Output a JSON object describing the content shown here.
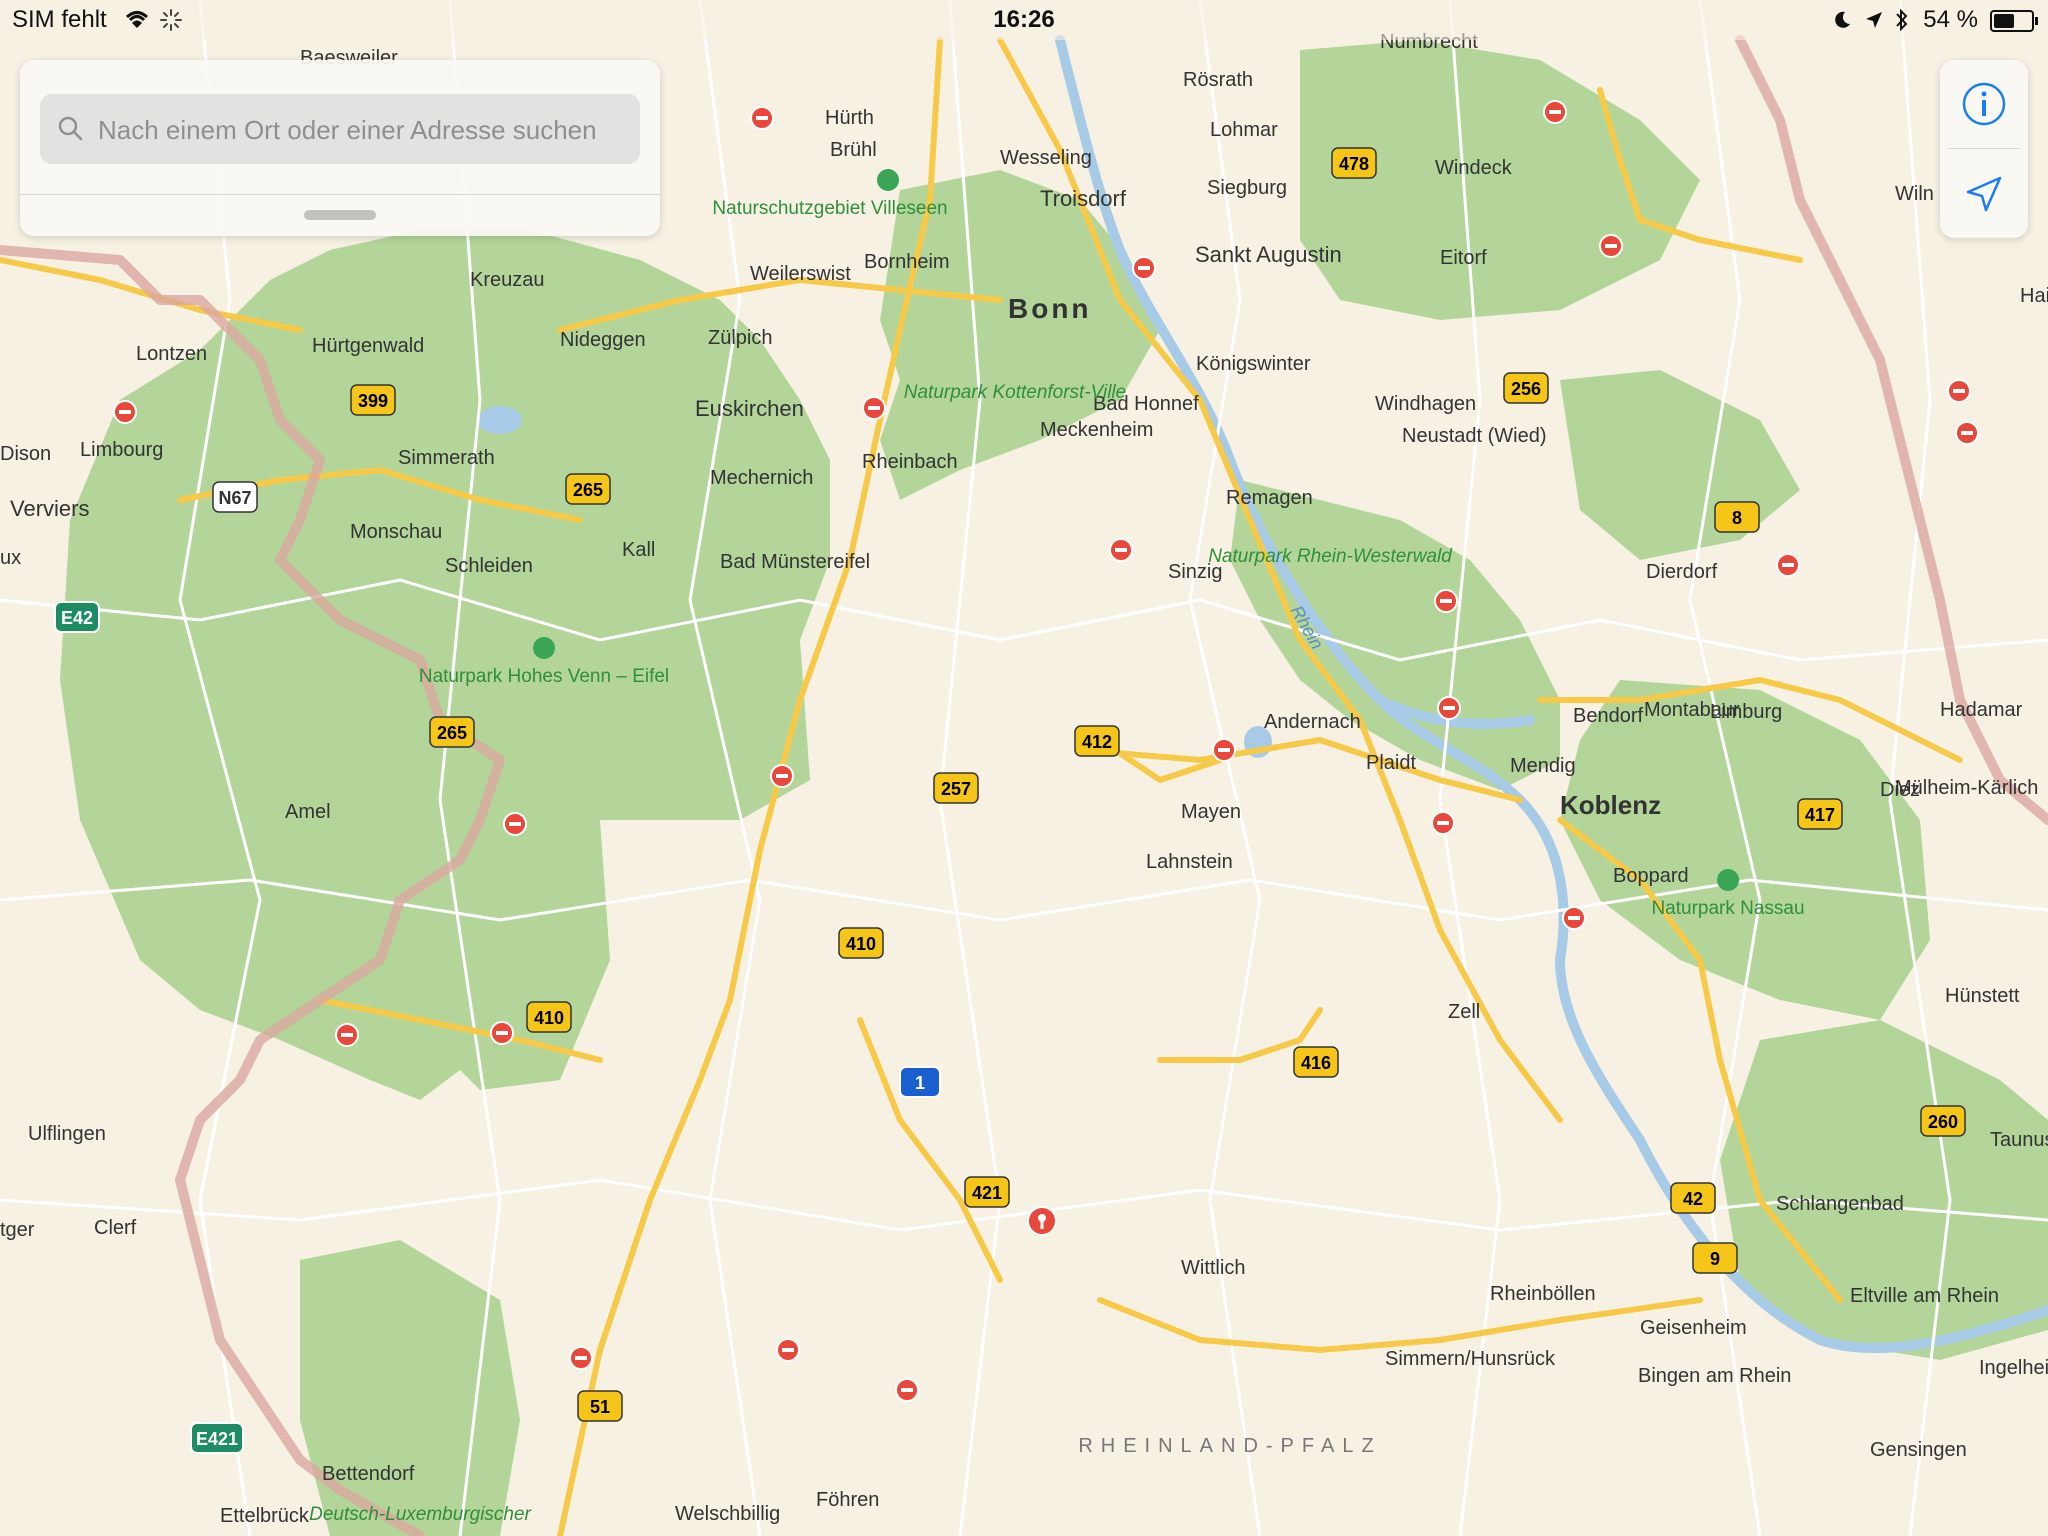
{
  "status_bar": {
    "carrier": "SIM fehlt",
    "time": "16:26",
    "battery": "54 %",
    "icons": [
      "wifi-icon",
      "activity-spinner-icon",
      "moon-icon",
      "location-arrow-icon",
      "bluetooth-icon",
      "battery-icon"
    ]
  },
  "search": {
    "placeholder": "Nach einem Ort oder einer Adresse suchen",
    "icon": "search-icon"
  },
  "controls": {
    "info_icon": "info-icon",
    "location_icon": "location-arrow-icon"
  },
  "colors": {
    "land": "#f7f1e3",
    "park": "#a8d08d",
    "road_major": "#f7c948",
    "road_minor": "#ffffff",
    "water": "#a7cbe6",
    "border": "#d9a7a0",
    "marker": "#e8473c",
    "shield": "#f5c518",
    "accent": "#1a7ef2"
  },
  "places": {
    "cities": [
      "Bonn",
      "Koblenz"
    ],
    "towns": [
      "Hürth",
      "Brühl",
      "Rösrath",
      "Lohmar",
      "Wesseling",
      "Troisdorf",
      "Siegburg",
      "Sankt Augustin",
      "Windeck",
      "Eitorf",
      "Bornheim",
      "Weilerswist",
      "Zülpich",
      "Euskirchen",
      "Nideggen",
      "Kreuzau",
      "Hürtgenwald",
      "Lontzen",
      "Limbourg",
      "Dison",
      "Verviers",
      "Simmerath",
      "Monschau",
      "Schleiden",
      "Mechernich",
      "Kall",
      "Bad Münstereifel",
      "Rheinbach",
      "Meckenheim",
      "Bad Honnef",
      "Königswinter",
      "Windhagen",
      "Neustadt (Wied)",
      "Remagen",
      "Sinzig",
      "Dierdorf",
      "Andernach",
      "Plaidt",
      "Bendorf",
      "Montabaur",
      "Hadamar",
      "Limburg",
      "Diez",
      "Mülheim-Kärlich",
      "Mendig",
      "Mayen",
      "Lahnstein",
      "Boppard",
      "Zell",
      "Wittlich",
      "Föhren",
      "Welschbillig",
      "Bettendorf",
      "Ettelbrück",
      "Clerf",
      "Ulflingen",
      "Amel",
      "Rheinböllen",
      "Simmern/Hunsrück",
      "Bingen am Rhein",
      "Geisenheim",
      "Eltville am Rhein",
      "Ingelheim",
      "Gensingen",
      "Schlangenbad",
      "Taunus",
      "Hünstett",
      "Numbrecht",
      "Baesweiler",
      "Wiln",
      "Hai",
      "ux",
      "tger"
    ],
    "parks": [
      "Naturschutzgebiet Villeseen",
      "Naturpark Kottenforst-Ville",
      "Naturpark Hohes Venn – Eifel",
      "Naturpark Rhein-Westerwald",
      "Naturpark Nassau",
      "Deutsch-Luxemburgischer"
    ],
    "region": "RHEINLAND-PFALZ",
    "river": "Rhein"
  },
  "shields": {
    "federal": [
      "478",
      "256",
      "399",
      "265",
      "265",
      "8",
      "412",
      "257",
      "410",
      "410",
      "416",
      "421",
      "417",
      "260",
      "42",
      "9",
      "51"
    ],
    "autobahn": [
      "1"
    ],
    "european": [
      "E42",
      "E421"
    ],
    "national": [
      "N67"
    ]
  }
}
